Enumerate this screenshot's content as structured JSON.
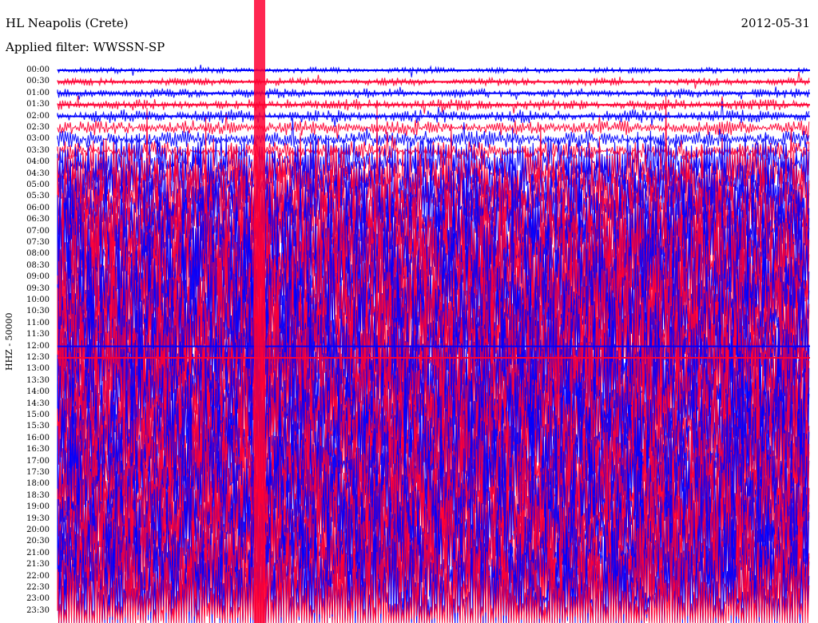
{
  "header": {
    "station": "HL Neapolis (Crete)",
    "filter": "Applied filter: WWSSN-SP",
    "date": "2012-05-31"
  },
  "chart_data": {
    "type": "helicorder",
    "title": "HL Neapolis (Crete)",
    "subtitle": "Applied filter: WWSSN-SP",
    "date": "2012-05-31",
    "ylabel": "HHZ - 50000",
    "line_times": [
      "00:00",
      "00:30",
      "01:00",
      "01:30",
      "02:00",
      "02:30",
      "03:00",
      "03:30",
      "04:00",
      "04:30",
      "05:00",
      "05:30",
      "06:00",
      "06:30",
      "07:00",
      "07:30",
      "08:00",
      "08:30",
      "09:00",
      "09:30",
      "10:00",
      "10:30",
      "11:00",
      "11:30",
      "12:00",
      "12:30",
      "13:00",
      "13:30",
      "14:00",
      "14:30",
      "15:00",
      "15:30",
      "16:00",
      "16:30",
      "17:00",
      "17:30",
      "18:00",
      "18:30",
      "19:00",
      "19:30",
      "20:00",
      "20:30",
      "21:00",
      "21:30",
      "22:00",
      "22:30",
      "23:00",
      "23:30"
    ],
    "trace_colors": [
      "#0000ff",
      "#ff0033"
    ],
    "minutes_per_line": 30,
    "grid": false
  }
}
